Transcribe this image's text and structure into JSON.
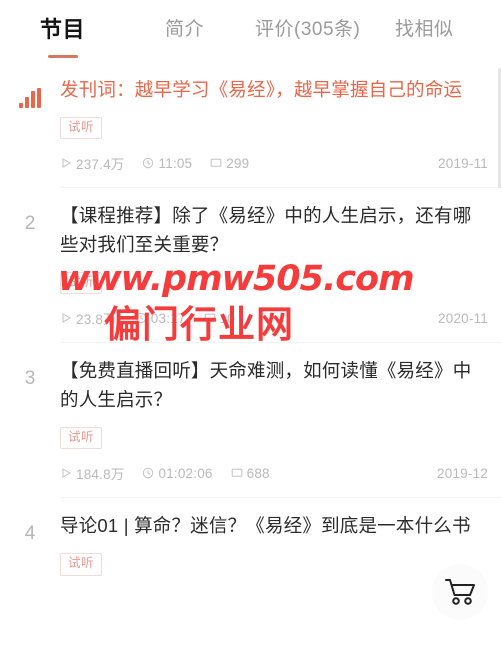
{
  "tabs": [
    {
      "label": "节目",
      "active": true
    },
    {
      "label": "简介",
      "active": false
    },
    {
      "label": "评价(305条)",
      "active": false
    },
    {
      "label": "找相似",
      "active": false
    }
  ],
  "colors": {
    "accent": "#e8664a",
    "underline": "#d4795d",
    "muted": "#b9b9b9",
    "title": "#2b2b2b",
    "badge_text": "#e39a92",
    "badge_border": "#f0dcd9",
    "watermark": "#f43c3c"
  },
  "episodes": [
    {
      "index": "",
      "playing": true,
      "title": "发刊词：越早学习《易经》，越早掌握自己的命运",
      "badge": "试听",
      "plays": "237.4万",
      "duration": "11:05",
      "comments": "299",
      "date": "2019-11"
    },
    {
      "index": "2",
      "playing": false,
      "title": "【课程推荐】除了《易经》中的人生启示，还有哪些对我们至关重要？",
      "badge": "试听",
      "plays": "23.8万",
      "duration": "03:17",
      "comments": "10",
      "date": "2020-11"
    },
    {
      "index": "3",
      "playing": false,
      "title": "【免费直播回听】天命难测，如何读懂《易经》中的人生启示？",
      "badge": "试听",
      "plays": "184.8万",
      "duration": "01:02:06",
      "comments": "688",
      "date": "2019-12"
    },
    {
      "index": "4",
      "playing": false,
      "title": "导论01 | 算命？迷信？《易经》到底是一本什么书",
      "badge": "试听",
      "plays": "",
      "duration": "",
      "comments": "",
      "date": ""
    }
  ],
  "floating": {
    "cart_label": "购物车"
  },
  "watermark": {
    "url": "www.pmw505.com",
    "site": "偏门行业网"
  }
}
